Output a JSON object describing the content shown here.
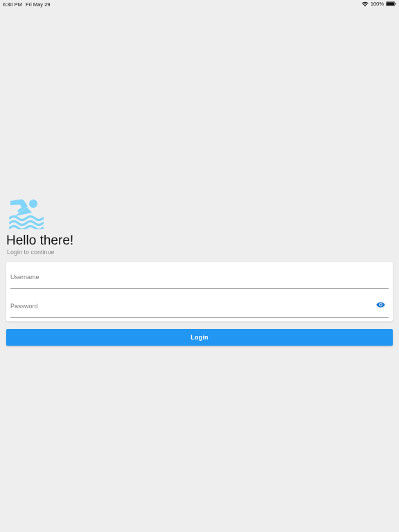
{
  "status_bar": {
    "time": "6:30 PM",
    "date": "Fri May 29",
    "battery": "100%",
    "icons": [
      "wifi-icon",
      "battery-icon"
    ]
  },
  "header": {
    "icon": "swimming-icon",
    "title": "Hello there!",
    "subtitle": "Login to continue"
  },
  "form": {
    "username": {
      "value": "",
      "placeholder": "Username"
    },
    "password": {
      "value": "",
      "placeholder": "Password",
      "toggle_icon": "eye-icon"
    },
    "login_label": "Login"
  },
  "colors": {
    "background": "#eeeeee",
    "accent": "#2196f3",
    "icon_light_blue": "#81d4fa",
    "eye_icon": "#1976d2"
  }
}
